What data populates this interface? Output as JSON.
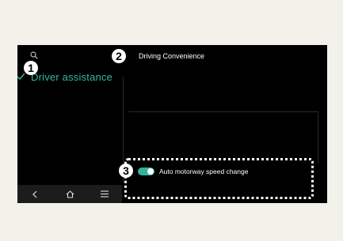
{
  "title": "Driving Convenience",
  "sidebar": {
    "selected_item": "Driver assistance"
  },
  "settings": [
    {
      "label": "Auto motorway speed change",
      "enabled": true
    }
  ],
  "navbar": {
    "back_icon": "chevron-left-icon",
    "home_icon": "home-icon",
    "menu_icon": "menu-icon"
  },
  "callouts": {
    "one": "1",
    "two": "2",
    "three": "3"
  },
  "colors": {
    "accent": "#2fb39d",
    "screen_bg": "#000000",
    "page_bg": "#f2f1ea"
  }
}
